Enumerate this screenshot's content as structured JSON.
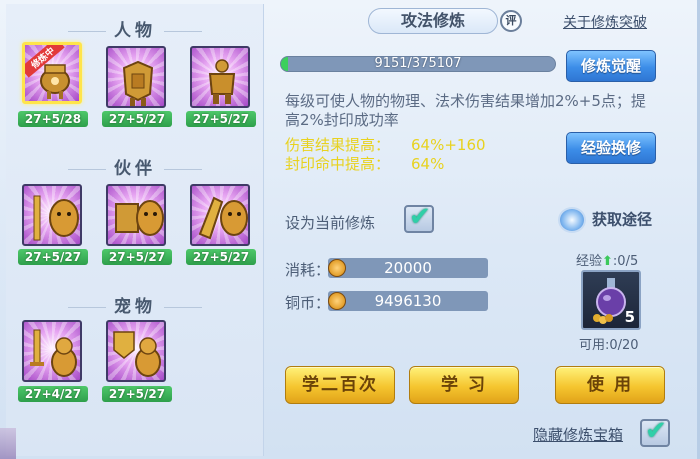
{
  "left": {
    "sections": [
      {
        "title": "人物",
        "slots": [
          {
            "label": "27+5/28",
            "badge": "修炼中",
            "selected": true
          },
          {
            "label": "27+5/27"
          },
          {
            "label": "27+5/27"
          }
        ]
      },
      {
        "title": "伙伴",
        "slots": [
          {
            "label": "27+5/27"
          },
          {
            "label": "27+5/27"
          },
          {
            "label": "27+5/27"
          }
        ]
      },
      {
        "title": "宠物",
        "slots": [
          {
            "label": "27+4/27"
          },
          {
            "label": "27+5/27"
          }
        ]
      }
    ]
  },
  "header": {
    "title": "攻法修炼",
    "eval_label": "评",
    "breakthrough_link": "关于修炼突破"
  },
  "progress": {
    "text": "9151/375107",
    "value": 9151,
    "max": 375107
  },
  "buttons": {
    "awaken": "修炼觉醒",
    "exchange": "经验换修",
    "learn_200": "学二百次",
    "learn": "学 习",
    "use": "使 用"
  },
  "description": "每级可使人物的物理、法术伤害结果增加2%+5点；提高2%封印成功率",
  "stats": [
    {
      "label": "伤害结果提高：",
      "value": "64%+160"
    },
    {
      "label": "封印命中提高：",
      "value": "64%"
    }
  ],
  "set_current": {
    "label": "设为当前修炼",
    "checked": true
  },
  "get_way": "获取途径",
  "cost": {
    "label": "消耗：",
    "value": "20000"
  },
  "copper": {
    "label": "铜币：",
    "value": "9496130"
  },
  "exp": {
    "label": "经验",
    "value": ":0/5"
  },
  "item": {
    "qty": "5"
  },
  "usable": "可用:0/20",
  "hide_chest": {
    "label": "隐藏修炼宝箱",
    "checked": true
  },
  "colors": {
    "level_green": "#2e9f4b",
    "accent_blue": "#3c8de8",
    "gold": "#f5c52f",
    "stat_yellow": "#e8d21f"
  }
}
